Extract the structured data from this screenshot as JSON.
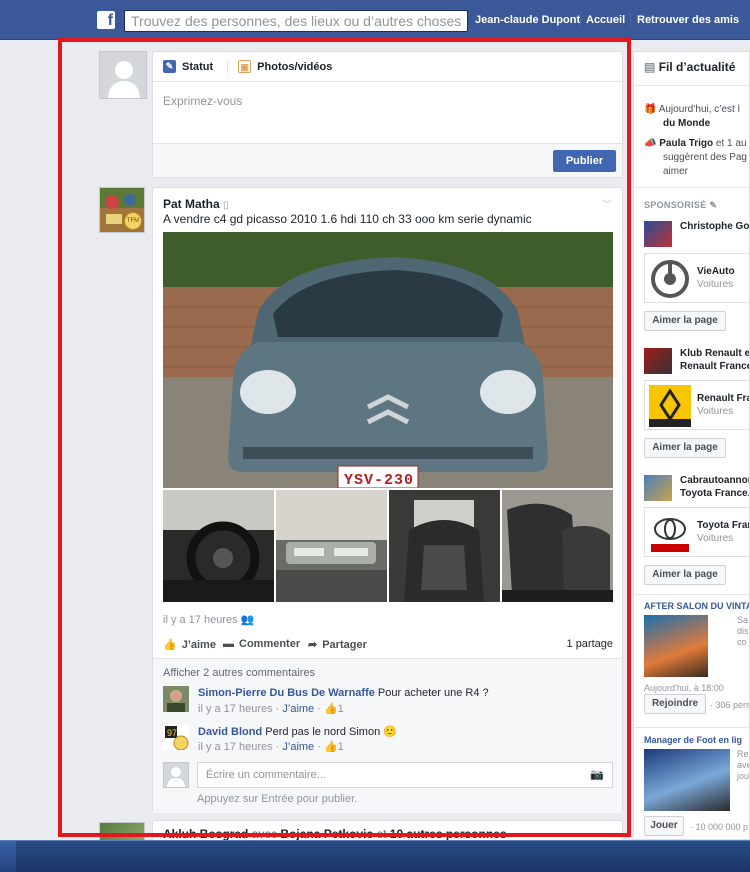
{
  "header": {
    "search_placeholder": "Trouvez des personnes, des lieux ou d’autres choses",
    "user_name": "Jean-claude Dupont",
    "home_label": "Accueil",
    "find_friends_label": "Retrouver des amis"
  },
  "composer": {
    "tab_status": "Statut",
    "tab_photos": "Photos/vidéos",
    "placeholder": "Exprimez-vous",
    "publish_label": "Publier"
  },
  "post": {
    "author": "Pat Matha",
    "text": "A vendre c4 gd picasso 2010 1.6 hdi 110 ch 33 ooo km serie dynamic",
    "plate": "YSV-230",
    "timestamp": "il y a 17 heures",
    "like_label": "J’aime",
    "comment_label": "Commenter",
    "share_label": "Partager",
    "shares_count": "1 partage",
    "more_comments": "Afficher 2 autres commentaires",
    "comments": [
      {
        "author": "Simon-Pierre Du Bus De Warnaffe",
        "text": "Pour acheter une R4 ?",
        "time": "il y a 17 heures",
        "like": "J’aime",
        "likes": "1"
      },
      {
        "author": "David Blond",
        "text": "Perd pas le nord Simon 🙂",
        "time": "il y a 17 heures",
        "like": "J’aime",
        "likes": "1"
      }
    ],
    "comment_placeholder": "Écrire un commentaire...",
    "press_enter": "Appuyez sur Entrée pour publier."
  },
  "next_post": {
    "author": "Akluh Bosgrad",
    "with": "avec",
    "tagged": "Bojana Petkovic",
    "and": "et",
    "others": "10 autres personnes"
  },
  "sidebar": {
    "feed_title": "Fil d’actualité",
    "birthday_line1": "Aujourd’hui, c’est l",
    "birthday_line2": "du Monde",
    "suggest_name": "Paula Trigo",
    "suggest_rest": "et 1 au",
    "suggest_line2": "suggèrent des Pag",
    "suggest_line3": "aimer",
    "sponsored": "SPONSORISÉ",
    "ad1_name": "Christophe Gou",
    "page1_name": "VieAuto",
    "page1_cat": "Voitures",
    "like_page": "Aimer la page",
    "ad2_line1": "Klub Renault et",
    "ad2_line2": "Renault France",
    "page2_name": "Renault Fra",
    "page2_cat": "Voitures",
    "ad3_line1": "Cabrautoannor",
    "ad3_line2": "Toyota France.",
    "page3_name": "Toyota Fran",
    "page3_cat": "Voitures",
    "event1_title": "AFTER SALON DU VINTA",
    "event1_desc": [
      "Sa",
      "dis",
      "co"
    ],
    "event1_time": "Aujourd'hui, à 18:00",
    "join_label": "Rejoindre",
    "event1_count": "· 306 pers",
    "event2_title": "Manager de Foot en lig",
    "event2_desc": [
      "Re",
      "ave",
      "jou"
    ],
    "play_label": "Jouer",
    "event2_count": "· 10 000 000 p"
  },
  "colors": {
    "brand": "#3b5998",
    "highlight": "#e3171d",
    "link": "#365899"
  }
}
